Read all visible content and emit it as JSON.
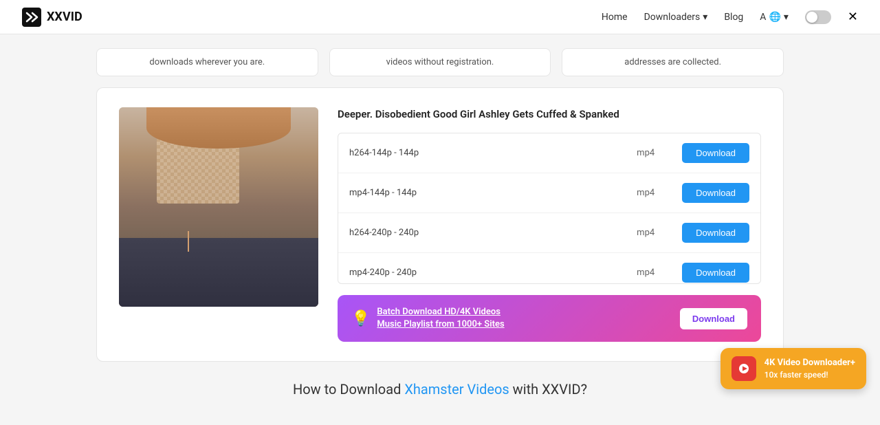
{
  "navbar": {
    "logo_text": "XXVID",
    "nav_home": "Home",
    "nav_downloaders": "Downloaders",
    "nav_blog": "Blog",
    "nav_translate": "A",
    "nav_translate_arrow": "▾"
  },
  "top_cards": [
    {
      "text": "downloads wherever you are."
    },
    {
      "text": "videos without registration."
    },
    {
      "text": "addresses are collected."
    }
  ],
  "video": {
    "title": "Deeper. Disobedient Good Girl Ashley Gets Cuffed & Spanked",
    "download_rows": [
      {
        "format": "h264-144p - 144p",
        "type": "mp4",
        "btn_label": "Download"
      },
      {
        "format": "mp4-144p - 144p",
        "type": "mp4",
        "btn_label": "Download"
      },
      {
        "format": "h264-240p - 240p",
        "type": "mp4",
        "btn_label": "Download"
      },
      {
        "format": "mp4-240p - 240p",
        "type": "mp4",
        "btn_label": "Download"
      }
    ]
  },
  "batch_banner": {
    "icon": "💡",
    "line1": "Batch Download HD/4K Videos",
    "line2": "Music Playlist from 1000+ Sites",
    "btn_label": "Download"
  },
  "bottom_heading": {
    "pre": "How to Download ",
    "highlight": "Xhamster Videos",
    "post": " with XXVID?"
  },
  "floating_widget": {
    "icon_label": "▶",
    "line1": "4K Video Downloader+",
    "line2": "10x faster speed!"
  }
}
